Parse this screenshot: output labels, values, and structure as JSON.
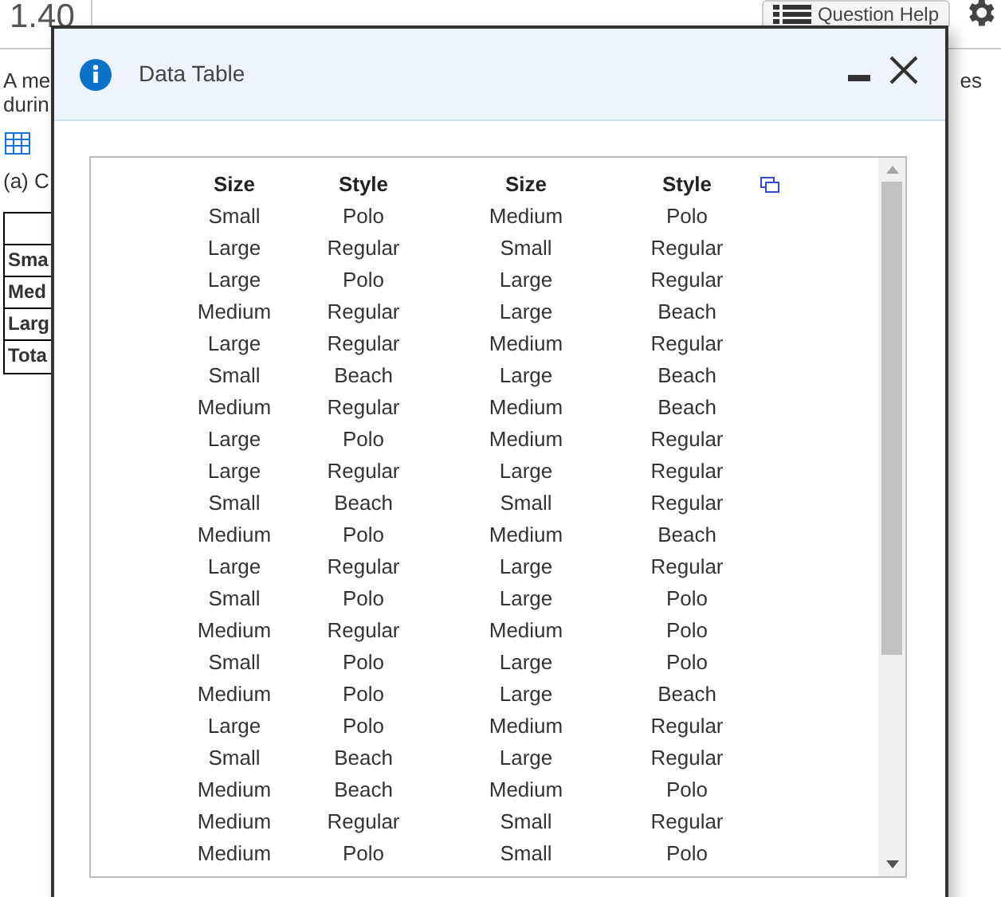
{
  "page": {
    "exercise_number": "1.40",
    "help_button": "Question Help",
    "intro_lines": [
      "A me",
      "durin"
    ],
    "intro_tail": "es",
    "part_label": "(a) C",
    "table_rows": [
      "Sma",
      "Med",
      "Larg",
      "Tota"
    ]
  },
  "dialog": {
    "title": "Data Table",
    "columns": [
      "Size",
      "Style",
      "Size",
      "Style"
    ],
    "rows": [
      [
        "Small",
        "Polo",
        "Medium",
        "Polo"
      ],
      [
        "Large",
        "Regular",
        "Small",
        "Regular"
      ],
      [
        "Large",
        "Polo",
        "Large",
        "Regular"
      ],
      [
        "Medium",
        "Regular",
        "Large",
        "Beach"
      ],
      [
        "Large",
        "Regular",
        "Medium",
        "Regular"
      ],
      [
        "Small",
        "Beach",
        "Large",
        "Beach"
      ],
      [
        "Medium",
        "Regular",
        "Medium",
        "Beach"
      ],
      [
        "Large",
        "Polo",
        "Medium",
        "Regular"
      ],
      [
        "Large",
        "Regular",
        "Large",
        "Regular"
      ],
      [
        "Small",
        "Beach",
        "Small",
        "Regular"
      ],
      [
        "Medium",
        "Polo",
        "Medium",
        "Beach"
      ],
      [
        "Large",
        "Regular",
        "Large",
        "Regular"
      ],
      [
        "Small",
        "Polo",
        "Large",
        "Polo"
      ],
      [
        "Medium",
        "Regular",
        "Medium",
        "Polo"
      ],
      [
        "Small",
        "Polo",
        "Large",
        "Polo"
      ],
      [
        "Medium",
        "Polo",
        "Large",
        "Beach"
      ],
      [
        "Large",
        "Polo",
        "Medium",
        "Regular"
      ],
      [
        "Small",
        "Beach",
        "Large",
        "Regular"
      ],
      [
        "Medium",
        "Beach",
        "Medium",
        "Polo"
      ],
      [
        "Medium",
        "Regular",
        "Small",
        "Regular"
      ],
      [
        "Medium",
        "Polo",
        "Small",
        "Polo"
      ]
    ]
  }
}
